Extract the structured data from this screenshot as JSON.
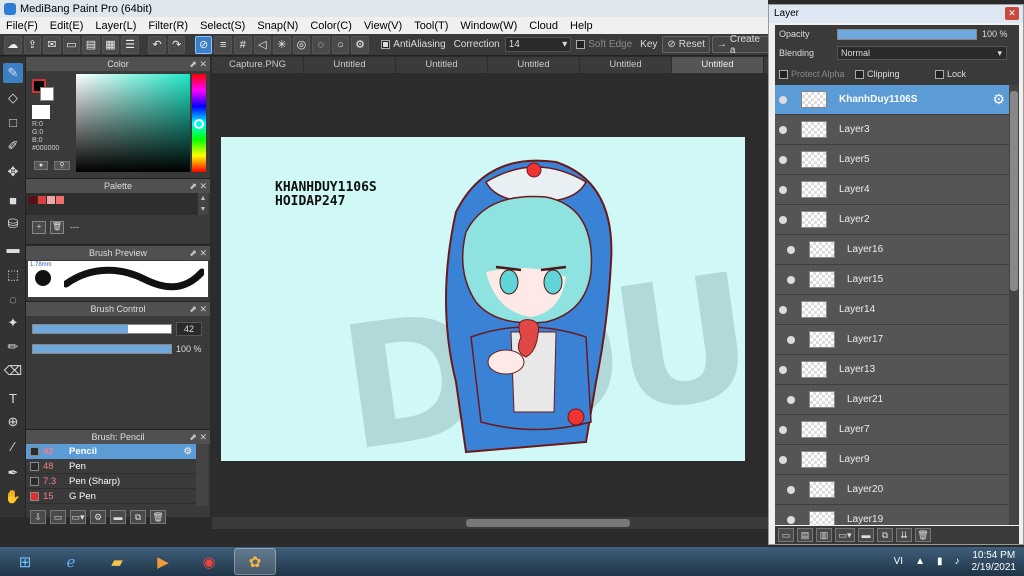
{
  "window": {
    "title": "MediBang Paint Pro (64bit)"
  },
  "menu": [
    "File(F)",
    "Edit(E)",
    "Layer(L)",
    "Filter(R)",
    "Select(S)",
    "Snap(N)",
    "Color(C)",
    "View(V)",
    "Tool(T)",
    "Window(W)",
    "Cloud",
    "Help"
  ],
  "toolbar": {
    "antialias_label": "AntiAliasing",
    "correction_label": "Correction",
    "correction_value": "14",
    "soft_edge_label": "Soft Edge",
    "key_label": "Key",
    "reset_label": "Reset",
    "create_label": "Create a"
  },
  "color_panel": {
    "title": "Color",
    "r": "R:0",
    "g": "G:0",
    "b": "B:0",
    "hex": "#000000"
  },
  "palette_panel": {
    "title": "Palette",
    "text": "---",
    "swatches": [
      "#5a1010",
      "#d94040",
      "#f2a6a6",
      "#f07070"
    ]
  },
  "brush_preview": {
    "title": "Brush Preview",
    "size_text": "1.78mm"
  },
  "brush_control": {
    "title": "Brush Control",
    "size": "42",
    "size_fraction": 0.69,
    "opacity": "100 %",
    "opacity_fraction": 1.0
  },
  "brush_list": {
    "title": "Brush: Pencil",
    "items": [
      {
        "size": "42",
        "name": "Pencil",
        "color": "#2b2b2b"
      },
      {
        "size": "48",
        "name": "Pen",
        "color": "#2b2b2b"
      },
      {
        "size": "7.3",
        "name": "Pen (Sharp)",
        "color": "#2b2b2b"
      },
      {
        "size": "15",
        "name": "G Pen",
        "color": "#e03030"
      }
    ]
  },
  "tabs": [
    "Capture.PNG",
    "Untitled",
    "Untitled",
    "Untitled",
    "Untitled",
    "Untitled"
  ],
  "canvas": {
    "text_line1": "KHANHDUY1106S",
    "text_line2": "HOIDAP247",
    "watermark": "DOUF"
  },
  "layer_panel": {
    "title": "Layer",
    "opacity_label": "Opacity",
    "opacity_value": "100 %",
    "blending_label": "Blending",
    "blending_value": "Normal",
    "protect_alpha_label": "Protect Alpha",
    "clipping_label": "Clipping",
    "lock_label": "Lock",
    "layers": [
      {
        "name": "KhanhDuy1106S"
      },
      {
        "name": "Layer3"
      },
      {
        "name": "Layer5"
      },
      {
        "name": "Layer4"
      },
      {
        "name": "Layer2"
      },
      {
        "name": "Layer16"
      },
      {
        "name": "Layer15"
      },
      {
        "name": "Layer14"
      },
      {
        "name": "Layer17"
      },
      {
        "name": "Layer13"
      },
      {
        "name": "Layer21"
      },
      {
        "name": "Layer7"
      },
      {
        "name": "Layer9"
      },
      {
        "name": "Layer20"
      },
      {
        "name": "Layer19"
      }
    ]
  },
  "taskbar": {
    "lang": "VI",
    "time": "10:54 PM",
    "date": "2/19/2021"
  }
}
